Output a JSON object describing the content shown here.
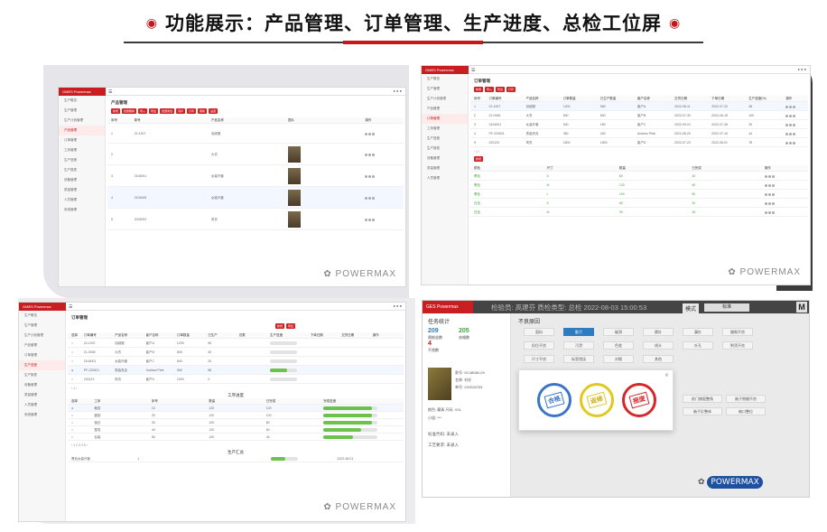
{
  "header": {
    "title": "功能展示：产品管理、订单管理、生产进度、总检工位屏",
    "bullet_char": "◉"
  },
  "colors": {
    "brand_red": "#c5171c",
    "accent_blue": "#2d7cc1"
  },
  "watermark": "POWERMAX",
  "panel1": {
    "brand": "GMES Powermax",
    "title": "产品管理",
    "buttons": [
      "新增",
      "批量删除",
      "导入",
      "导出",
      "批量修改",
      "同步",
      "打印",
      "刷新",
      "设置"
    ],
    "columns": [
      "序号",
      "款号",
      "产品名称",
      "图片",
      "操作"
    ],
    "rows": [
      [
        "1",
        "22-1007",
        "羽绒服",
        "",
        ""
      ],
      [
        "2",
        "",
        "大衣",
        "",
        ""
      ],
      [
        "3",
        "2104001",
        "女装外套",
        "",
        ""
      ],
      [
        "4",
        "2104005",
        "女装外套",
        "",
        ""
      ],
      [
        "5",
        "2003002",
        "风衣",
        "",
        ""
      ]
    ],
    "sidebar": [
      "生产概览",
      "生产管理",
      "生产计划管理",
      "产品管理",
      "订单管理",
      "工序管理",
      "生产进度",
      "生产报表",
      "设备管理",
      "质量管理",
      "人员管理",
      "系统管理"
    ]
  },
  "panel2": {
    "title": "订单管理",
    "buttons": [
      "新增",
      "导入",
      "导出",
      "打印"
    ],
    "columns": [
      "序号",
      "订单编号",
      "产品名称",
      "订单数量",
      "已生产数量",
      "客户名称",
      "交货日期",
      "下单日期",
      "生产进度(%)",
      "操作"
    ],
    "rows": [
      [
        "1",
        "22-1007",
        "羽绒服",
        "1200",
        "560",
        "客户A",
        "2022-08-11",
        "2022-07-20",
        "48"
      ],
      [
        "2",
        "21-0945",
        "大衣",
        "800",
        "800",
        "客户B",
        "2022-07-30",
        "2022-06-15",
        "100"
      ],
      [
        "3",
        "2104001",
        "女装外套",
        "600",
        "180",
        "客户C",
        "2022-09-01",
        "2022-07-28",
        "30"
      ],
      [
        "4",
        "PF-220521",
        "男装夹克",
        "950",
        "420",
        "Andrew Pete",
        "2022-08-20",
        "2022-07-10",
        "44"
      ],
      [
        "5",
        "220123",
        "风衣",
        "1500",
        "1500",
        "客户D",
        "2022-07-22",
        "2022-06-01",
        "78"
      ]
    ],
    "sub_columns": [
      "颜色",
      "尺寸",
      "数量",
      "已完成",
      "操作"
    ],
    "sub_rows": [
      [
        "黑色",
        "S",
        "80",
        "40"
      ],
      [
        "黑色",
        "M",
        "120",
        "60"
      ],
      [
        "黑色",
        "L",
        "100",
        "50"
      ],
      [
        "白色",
        "S",
        "80",
        "20"
      ],
      [
        "白色",
        "M",
        "90",
        "45"
      ]
    ]
  },
  "panel3": {
    "title": "订单管理",
    "columns": [
      "选择",
      "订单编号",
      "产品名称",
      "客户名称",
      "订单数量",
      "已生产",
      "总数",
      "生产进度",
      "下单日期",
      "交货日期",
      "操作"
    ],
    "rows": [
      [
        "22-1007",
        "羽绒服",
        "客户A",
        "1200",
        "60"
      ],
      [
        "21-0945",
        "大衣",
        "客户B",
        "800",
        "40"
      ],
      [
        "2104001",
        "女装外套",
        "客户C",
        "600",
        "20"
      ],
      [
        "PF-220521",
        "男装夹克",
        "Andrew Pete",
        "950",
        "88"
      ],
      [
        "220123",
        "风衣",
        "客户D",
        "1500",
        "0"
      ]
    ],
    "progress": [
      0,
      0,
      0,
      0.62,
      0
    ],
    "mid_title": "工序进度",
    "mid_columns": [
      "选择",
      "工序",
      "序号",
      "数量",
      "已完成",
      "完成进度"
    ],
    "mid_rows": [
      [
        "裁剪",
        "10",
        "120",
        "120"
      ],
      [
        "缝制",
        "20",
        "120",
        "100"
      ],
      [
        "锁边",
        "30",
        "120",
        "80"
      ],
      [
        "整烫",
        "40",
        "120",
        "60"
      ],
      [
        "包装",
        "50",
        "120",
        "40"
      ]
    ],
    "mid_progress": [
      0.9,
      0.9,
      0.9,
      0.7,
      0.55
    ],
    "bottom_title": "生产汇总",
    "bottom_row": [
      "黑色女装外套",
      "1",
      "",
      "",
      "",
      "2022-08-01"
    ]
  },
  "panel4": {
    "brand": "GES Powermax",
    "topbar": "检验员: 高建芬  质检类型: 总检  2022-08-03 15:00:53",
    "mode_label": "模式",
    "mode_value": "标准",
    "logo": "M",
    "task_title": "任务统计",
    "stats": [
      {
        "n": "209",
        "cap": "质检总数",
        "color": "#2d7cc1"
      },
      {
        "n": "205",
        "cap": "合格数",
        "color": "#3aa83a"
      },
      {
        "n": "4",
        "cap": "不良数",
        "color": "#c5171c"
      }
    ],
    "info": [
      "款号: SC48080-09",
      "名称: 衬衫",
      "单号: 220228753",
      "颜色: 藏青   尺码: XXL",
      "小组: ***"
    ],
    "fields": [
      "标准代码: 未录入",
      "工艺要求: 未录入"
    ],
    "defect_title": "不良原因",
    "defects": [
      "面料",
      "脏污",
      "破洞",
      "跳针",
      "漏针",
      "缝制不良",
      "扣位不良",
      "污渍",
      "色差",
      "线头",
      "针孔",
      "熨烫不良",
      "尺寸不良",
      "标签错误",
      "对格",
      "其他"
    ],
    "bottom_defects": [
      "前门襟面整角",
      "袖子侧缝不良",
      "袖子反整体",
      "袖口整位"
    ],
    "modal_stamps": [
      {
        "label": "合格",
        "color": "#3a74c9"
      },
      {
        "label": "返修",
        "color": "#e0c81c"
      },
      {
        "label": "报废",
        "color": "#d6262a"
      }
    ],
    "wechat_label": "POWERMAX"
  }
}
